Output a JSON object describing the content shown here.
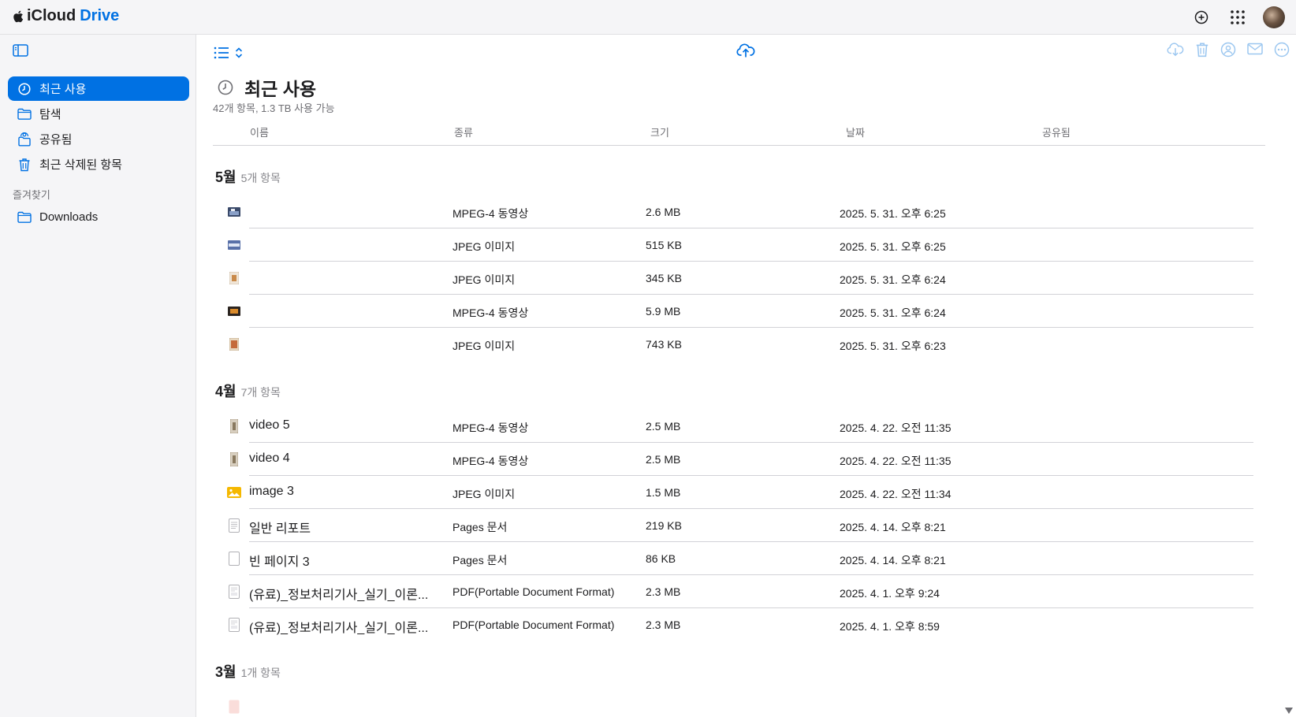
{
  "app": {
    "brand_icloud": "iCloud",
    "brand_drive": "Drive"
  },
  "colors": {
    "accent": "#0071e3",
    "sidebar_bg": "#f5f5f7",
    "divider": "#d2d2d7",
    "secondary_text": "#6e6e73"
  },
  "topbar": {
    "icons": [
      "add-icon",
      "app-grid-icon",
      "avatar"
    ]
  },
  "sidebar": {
    "items": [
      {
        "label": "최근 사용",
        "icon": "clock-icon",
        "active": true
      },
      {
        "label": "탐색",
        "icon": "folder-icon",
        "active": false
      },
      {
        "label": "공유됨",
        "icon": "shared-folder-icon",
        "active": false
      },
      {
        "label": "최근 삭제된 항목",
        "icon": "trash-icon",
        "active": false
      }
    ],
    "favorites_title": "즐겨찾기",
    "favorites": [
      {
        "label": "Downloads",
        "icon": "folder-icon"
      }
    ]
  },
  "toolbar": {
    "left_icons": [
      "list-view-icon",
      "sort-chevrons-icon"
    ],
    "center_icon": "upload-icon",
    "right_icons": [
      "download-icon",
      "trash-icon",
      "share-person-icon",
      "mail-icon",
      "more-icon"
    ]
  },
  "main": {
    "title": "최근 사용",
    "subtitle": "42개 항목, 1.3 TB 사용 가능",
    "columns": {
      "name": "이름",
      "kind": "종류",
      "size": "크기",
      "date": "날짜",
      "shared": "공유됨"
    }
  },
  "groups": [
    {
      "month": "5월",
      "count": "5개 항목",
      "rows": [
        {
          "name": "",
          "kind": "MPEG-4 동영상",
          "size": "2.6 MB",
          "date": "2025. 5. 31. 오후 6:25",
          "thumb": "video-thumb-icon"
        },
        {
          "name": "",
          "kind": "JPEG 이미지",
          "size": "515 KB",
          "date": "2025. 5. 31. 오후 6:25",
          "thumb": "image-thumb-icon"
        },
        {
          "name": "",
          "kind": "JPEG 이미지",
          "size": "345 KB",
          "date": "2025. 5. 31. 오후 6:24",
          "thumb": "image-thumb-icon"
        },
        {
          "name": "",
          "kind": "MPEG-4 동영상",
          "size": "5.9 MB",
          "date": "2025. 5. 31. 오후 6:24",
          "thumb": "video-thumb-icon"
        },
        {
          "name": "",
          "kind": "JPEG 이미지",
          "size": "743 KB",
          "date": "2025. 5. 31. 오후 6:23",
          "thumb": "image-thumb-icon"
        }
      ]
    },
    {
      "month": "4월",
      "count": "7개 항목",
      "rows": [
        {
          "name": "video 5",
          "kind": "MPEG-4 동영상",
          "size": "2.5 MB",
          "date": "2025. 4. 22. 오전 11:35",
          "thumb": "video-thumb-icon"
        },
        {
          "name": "video 4",
          "kind": "MPEG-4 동영상",
          "size": "2.5 MB",
          "date": "2025. 4. 22. 오전 11:35",
          "thumb": "video-thumb-icon"
        },
        {
          "name": "image 3",
          "kind": "JPEG 이미지",
          "size": "1.5 MB",
          "date": "2025. 4. 22. 오전 11:34",
          "thumb": "photo-icon"
        },
        {
          "name": "일반 리포트",
          "kind": "Pages 문서",
          "size": "219 KB",
          "date": "2025. 4. 14. 오후 8:21",
          "thumb": "document-icon"
        },
        {
          "name": "빈 페이지 3",
          "kind": "Pages 문서",
          "size": "86 KB",
          "date": "2025. 4. 14. 오후 8:21",
          "thumb": "blank-document-icon"
        },
        {
          "name": "(유료)_정보처리기사_실기_이론...",
          "kind": "PDF(Portable Document Format)",
          "size": "2.3 MB",
          "date": "2025. 4. 1. 오후 9:24",
          "thumb": "pdf-icon"
        },
        {
          "name": "(유료)_정보처리기사_실기_이론...",
          "kind": "PDF(Portable Document Format)",
          "size": "2.3 MB",
          "date": "2025. 4. 1. 오후 8:59",
          "thumb": "pdf-icon"
        }
      ]
    },
    {
      "month": "3월",
      "count": "1개 항목",
      "rows": []
    }
  ]
}
